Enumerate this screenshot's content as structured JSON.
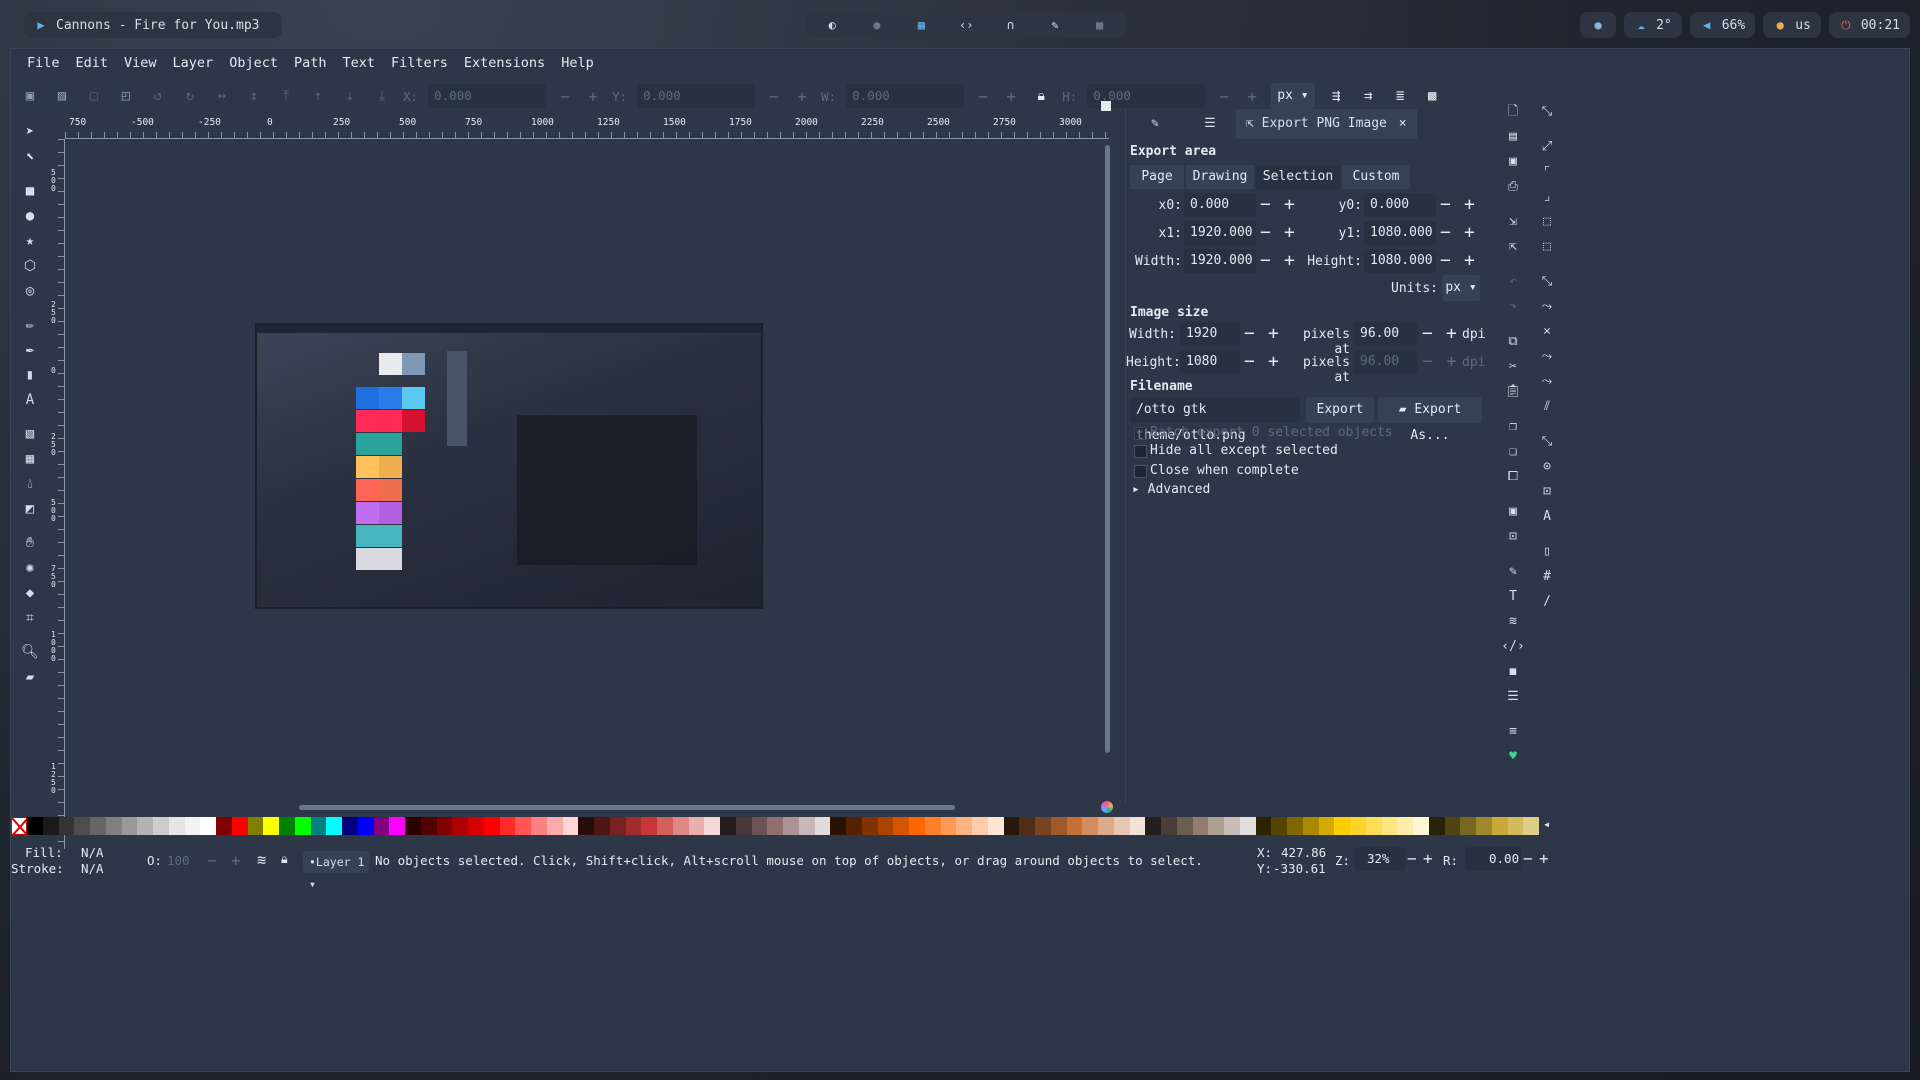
{
  "topbar": {
    "window_title": "Cannons - Fire for You.mp3",
    "weather": "2°",
    "volume": "66%",
    "keyboard_layout": "us",
    "clock": "00:21"
  },
  "menu": [
    "File",
    "Edit",
    "View",
    "Layer",
    "Object",
    "Path",
    "Text",
    "Filters",
    "Extensions",
    "Help"
  ],
  "tool_controls": {
    "x_label": "X:",
    "x_value": "0.000",
    "y_label": "Y:",
    "y_value": "0.000",
    "w_label": "W:",
    "w_value": "0.000",
    "h_label": "H:",
    "h_value": "0.000",
    "unit": "px"
  },
  "ruler_top_labels": [
    "750",
    "-500",
    "-250",
    "0",
    "250",
    "500",
    "750",
    "1000",
    "1250",
    "1500",
    "1750",
    "2000",
    "2250",
    "2500",
    "2750",
    "3000"
  ],
  "ruler_left_labels": [
    "500",
    "250",
    "0",
    "250",
    "500",
    "750",
    "1000",
    "1250"
  ],
  "export_dialog": {
    "tab_label": "Export PNG Image",
    "export_area_heading": "Export area",
    "area_tabs": [
      "Page",
      "Drawing",
      "Selection",
      "Custom"
    ],
    "x0_label": "x0:",
    "x0": "0.000",
    "y0_label": "y0:",
    "y0": "0.000",
    "x1_label": "x1:",
    "x1": "1920.000",
    "y1_label": "y1:",
    "y1": "1080.000",
    "width_label": "Width:",
    "width": "1920.000",
    "height_label": "Height:",
    "height": "1080.000",
    "units_label": "Units:",
    "units": "px",
    "image_size_heading": "Image size",
    "img_width_label": "Width:",
    "img_width": "1920",
    "img_height_label": "Height:",
    "img_height": "1080",
    "pixels_at": "pixels at",
    "dpi_value": "96.00",
    "dpi_value_dim": "96.00",
    "dpi_label": "dpi",
    "filename_heading": "Filename",
    "filename": "/otto gtk theme/otto.png",
    "export_button": "Export",
    "export_as_button": "Export As...",
    "batch_export": "Batch export 0 selected objects",
    "hide_all": "Hide all except selected",
    "close_when_complete": "Close when complete",
    "advanced": "Advanced"
  },
  "palette_colors": [
    "#000000",
    "#1a1a1a",
    "#333333",
    "#4d4d4d",
    "#666666",
    "#808080",
    "#999999",
    "#b3b3b3",
    "#cccccc",
    "#e6e6e6",
    "#f2f2f2",
    "#ffffff",
    "#800000",
    "#ff0000",
    "#808000",
    "#ffff00",
    "#008000",
    "#00ff00",
    "#008080",
    "#00ffff",
    "#000080",
    "#0000ff",
    "#800080",
    "#ff00ff",
    "#2b0000",
    "#550000",
    "#800000",
    "#aa0000",
    "#d40000",
    "#ff0000",
    "#ff2a2a",
    "#ff5555",
    "#ff8080",
    "#ffaaaa",
    "#ffd5d5",
    "#280b0b",
    "#501616",
    "#782121",
    "#a02c2c",
    "#c83737",
    "#d35f5f",
    "#de8787",
    "#e9afaf",
    "#f4d7d7",
    "#241c1c",
    "#483737",
    "#6c5353",
    "#916f6f",
    "#ac9393",
    "#c8b7b7",
    "#e3dbdb",
    "#2b1100",
    "#552200",
    "#803300",
    "#aa4400",
    "#d45500",
    "#ff6600",
    "#ff7f2a",
    "#ff9955",
    "#ffb380",
    "#ffccaa",
    "#ffe6d5",
    "#28170b",
    "#502d16",
    "#784421",
    "#a05a2c",
    "#c87137",
    "#d38d5f",
    "#deaa87",
    "#e9c6af",
    "#f4e3d7",
    "#241f1c",
    "#483e37",
    "#6c5d53",
    "#917c6f",
    "#ac9d93",
    "#c8beb7",
    "#e3dedb",
    "#2b2200",
    "#554400",
    "#806600",
    "#aa8800",
    "#d4aa00",
    "#ffcc00",
    "#ffd42a",
    "#ffdd55",
    "#ffe680",
    "#ffeeaa",
    "#fff6d5",
    "#28220b",
    "#504416",
    "#786721",
    "#a0892c",
    "#c8ab37",
    "#d3bc5f",
    "#decd87"
  ],
  "status": {
    "fill_label": "Fill:",
    "fill_value": "N/A",
    "stroke_label": "Stroke:",
    "stroke_value": "N/A",
    "opacity_label": "O:",
    "opacity_value": "100",
    "layer": "•Layer 1",
    "message": "No objects selected. Click, Shift+click, Alt+scroll mouse on top of objects, or drag around objects to select.",
    "x_label": "X:",
    "x_value": "427.86",
    "y_label": "Y:",
    "y_value": "-330.61",
    "zoom_label": "Z:",
    "zoom_value": "32%",
    "rotate_label": "R:",
    "rotate_value": "0.00"
  },
  "canvas_swatches": {
    "colors": [
      "#e8eaee",
      "#7f98b5",
      "#1e6fe0",
      "#2a7de8",
      "#5ac8f0",
      "#ff2a55",
      "#ff2a55",
      "#d4112f",
      "#2aa39b",
      "#2aa39b",
      "#ffc15c",
      "#f0b050",
      "#ff6655",
      "#f06e50",
      "#c06ef0",
      "#b060e0",
      "#48b6c0",
      "#48b6c0",
      "#d8dadf",
      "#d8dadf"
    ]
  }
}
